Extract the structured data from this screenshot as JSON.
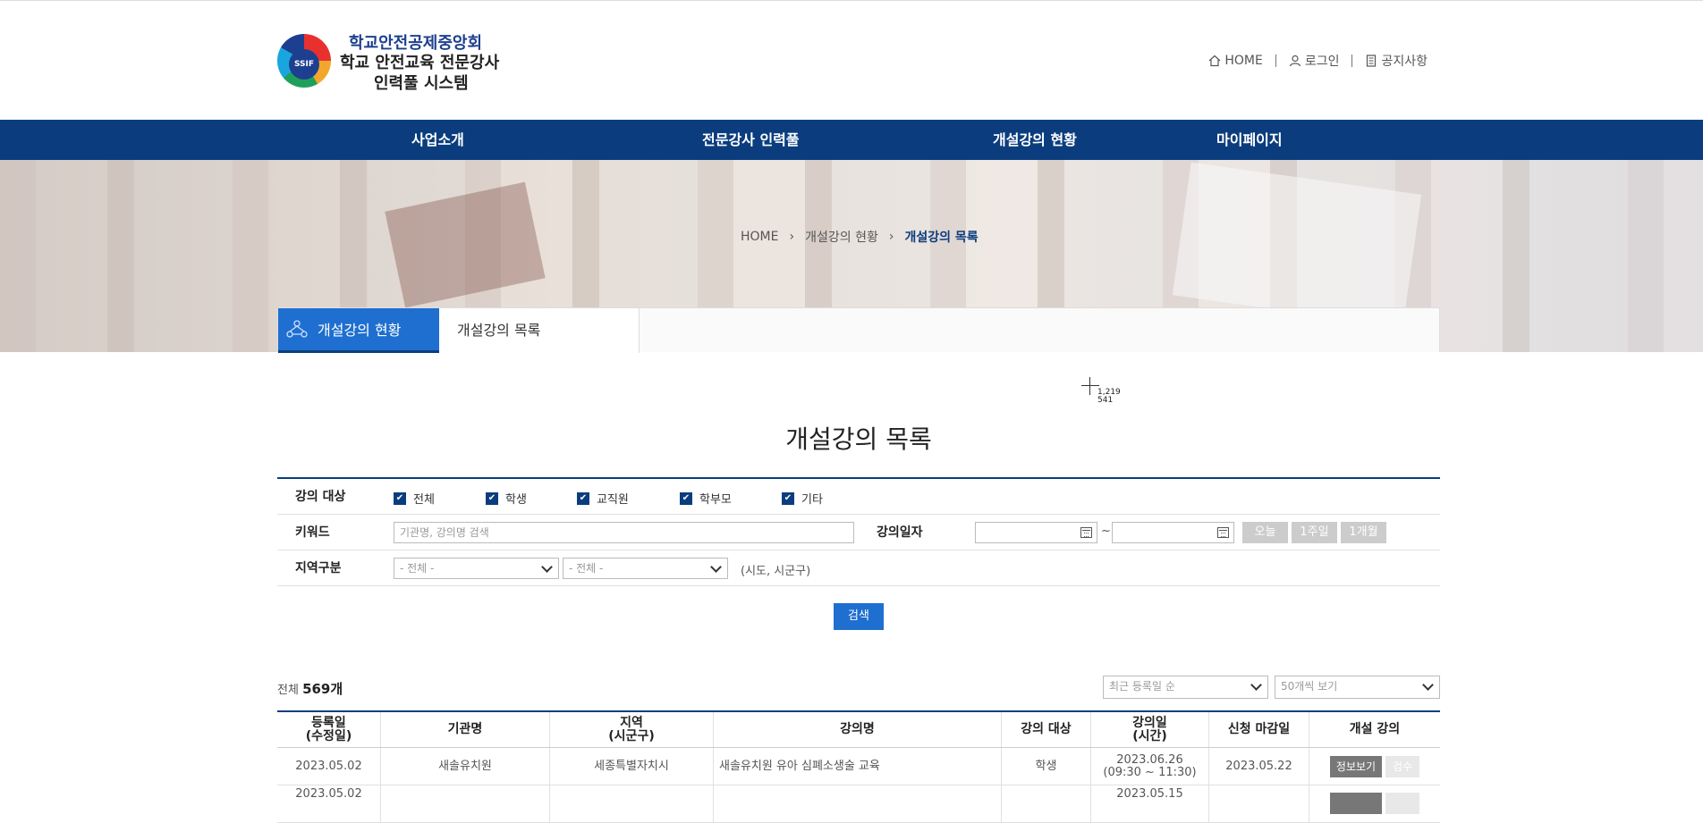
{
  "header": {
    "logo_badge": "SSIF",
    "logo_line1": "학교안전공제중앙회",
    "logo_line2": "학교 안전교육 전문강사",
    "logo_line3": "인력풀 시스템",
    "util": [
      {
        "label": "HOME",
        "icon": "home-icon"
      },
      {
        "label": "로그인",
        "icon": "user-icon"
      },
      {
        "label": "공지사항",
        "icon": "notice-icon"
      }
    ]
  },
  "gnb": [
    "사업소개",
    "전문강사 인력풀",
    "개설강의 현황",
    "마이페이지"
  ],
  "breadcrumb": [
    "HOME",
    "개설강의 현황",
    "개설강의 목록"
  ],
  "subtabs": [
    "개설강의 현황",
    "개설강의 목록"
  ],
  "cursor": {
    "x": "1,219",
    "y": "541"
  },
  "page_title": "개설강의 목록",
  "search": {
    "target_label": "강의 대상",
    "targets": [
      "전체",
      "학생",
      "교직원",
      "학부모",
      "기타"
    ],
    "keyword_label": "키워드",
    "keyword_placeholder": "기관명, 강의명 검색",
    "date_label": "강의일자",
    "date_sep": "~",
    "date_buttons": [
      "오늘",
      "1주일",
      "1개월"
    ],
    "region_label": "지역구분",
    "region1": "- 전체 -",
    "region2": "- 전체 -",
    "region_hint": "(시도, 시군구)",
    "submit": "검색"
  },
  "list": {
    "total_prefix": "전체",
    "total_count": "569개",
    "sort": "최근 등록일 순",
    "per_page": "50개씩 보기"
  },
  "table": {
    "headers": [
      "등록일\n(수정일)",
      "기관명",
      "지역\n(시군구)",
      "강의명",
      "강의 대상",
      "강의일\n(시간)",
      "신청 마감일",
      "개설 강의"
    ],
    "rows": [
      {
        "reg_date": "2023.05.02",
        "org": "새솔유치원",
        "region": "세종특별자치시",
        "title": "새솔유치원 유아 심폐소생술 교육",
        "target": "학생",
        "lecture_date": "2023.06.26",
        "lecture_time": "(09:30 ~ 11:30)",
        "deadline": "2023.05.22",
        "btn_info": "정보보기",
        "btn_review": "검수"
      },
      {
        "reg_date": "2023.05.02",
        "org": "",
        "region": "",
        "title": "",
        "target": "",
        "lecture_date": "2023.05.15",
        "lecture_time": "",
        "deadline": "",
        "btn_info": "",
        "btn_review": ""
      }
    ]
  }
}
